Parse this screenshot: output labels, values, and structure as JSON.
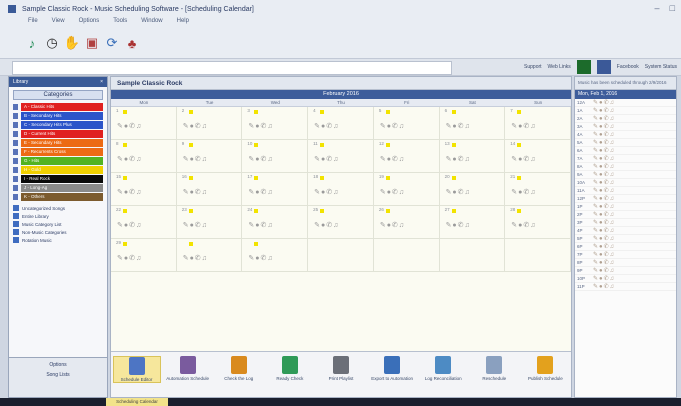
{
  "window": {
    "title": "Sample Classic Rock - Music Scheduling Software - [Scheduling Calendar]"
  },
  "menu": [
    "File",
    "View",
    "Options",
    "Tools",
    "Window",
    "Help"
  ],
  "toolbar_icons": [
    "music-note-icon",
    "clock-icon",
    "thumbs-icon",
    "badge-icon",
    "refresh-icon",
    "fire-icon"
  ],
  "social": {
    "support": "Support",
    "web": "Web Links",
    "facebook": "Facebook",
    "system": "System Status"
  },
  "sidebar": {
    "title": "Library",
    "categories_title": "Categories",
    "categories": [
      {
        "label": "A - Classic Hits",
        "color": "#e02020"
      },
      {
        "label": "B - Secondary Hits",
        "color": "#2b54c9"
      },
      {
        "label": "C - Secondary Hits Plus",
        "color": "#2b54c9"
      },
      {
        "label": "D - Current Hits",
        "color": "#e02020"
      },
      {
        "label": "E - Secondary Hits",
        "color": "#ec6a14"
      },
      {
        "label": "F - Recurrents Cross",
        "color": "#ec6a14"
      },
      {
        "label": "G - Hits",
        "color": "#52b322"
      },
      {
        "label": "H - Gold",
        "color": "#f0d000"
      },
      {
        "label": "I - Real Rock",
        "color": "#0a0a0a"
      },
      {
        "label": "J - Long-Ag",
        "color": "#8a8a8a"
      },
      {
        "label": "K - Others",
        "color": "#7c5b2e"
      }
    ],
    "libraries": [
      "Uncategorized Songs",
      "Entire Library",
      "Music Category List",
      "Non-Music Categories",
      "Rotation Music"
    ],
    "bottom_labels": [
      "Options",
      "Song Lists"
    ]
  },
  "main": {
    "title": "Sample Classic Rock",
    "month": "February 2016",
    "days": [
      "Mon",
      "Tue",
      "Wed",
      "Thu",
      "Fri",
      "Sat",
      "Sun"
    ],
    "weeks": [
      [
        "1",
        "2",
        "3",
        "4",
        "5",
        "6",
        "7"
      ],
      [
        "8",
        "9",
        "10",
        "11",
        "12",
        "13",
        "14"
      ],
      [
        "15",
        "16",
        "17",
        "18",
        "19",
        "20",
        "21"
      ],
      [
        "22",
        "23",
        "24",
        "25",
        "26",
        "27",
        "28"
      ],
      [
        "29",
        "",
        "",
        "",
        "",
        "",
        ""
      ]
    ]
  },
  "bottom_tools": [
    {
      "label": "Schedule Editor",
      "color": "#4d75c4"
    },
    {
      "label": "Automation Schedule",
      "color": "#7a5b9e"
    },
    {
      "label": "Check the Log",
      "color": "#d98a1e"
    },
    {
      "label": "Ready Check",
      "color": "#2f9a57"
    },
    {
      "label": "Print Playlist",
      "color": "#6b6f78"
    },
    {
      "label": "Export to Automation",
      "color": "#3a6fb9"
    },
    {
      "label": "Log Reconciliation",
      "color": "#4d8bc4"
    },
    {
      "label": "Reschedule",
      "color": "#8aa0bf"
    },
    {
      "label": "Publish Schedule",
      "color": "#e3a11d"
    }
  ],
  "right_panel": {
    "status": "Music has been scheduled through 2/9/2016",
    "date": "Mon, Feb 1, 2016",
    "hours": [
      "12A",
      "1A",
      "2A",
      "3A",
      "4A",
      "5A",
      "6A",
      "7A",
      "8A",
      "9A",
      "10A",
      "11A",
      "12P",
      "1P",
      "2P",
      "3P",
      "4P",
      "5P",
      "6P",
      "7P",
      "8P",
      "9P",
      "10P",
      "11P"
    ]
  },
  "taskbar_tab": "Scheduling Calendar"
}
